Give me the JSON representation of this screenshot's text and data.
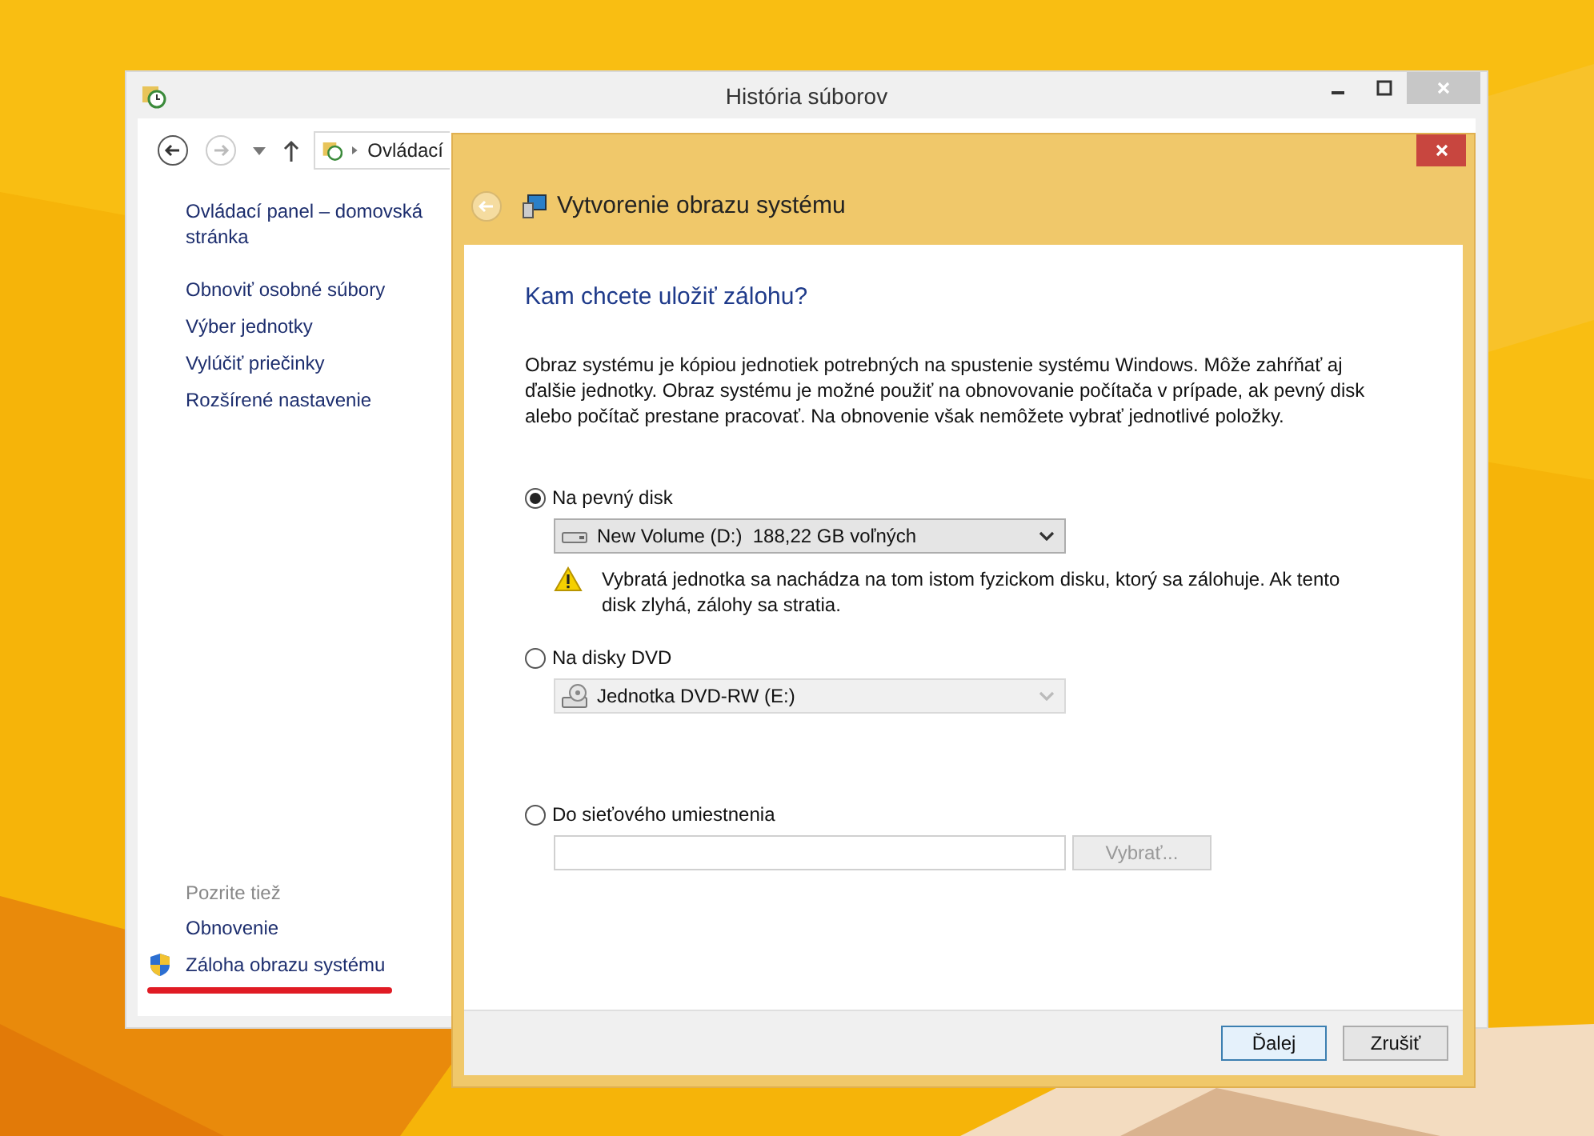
{
  "back_window": {
    "title": "História súborov",
    "address": "Ovládací",
    "links": [
      "Ovládací panel – domovská stránka",
      "Obnoviť osobné súbory",
      "Výber jednotky",
      "Vylúčiť priečinky",
      "Rozšírené nastavenie"
    ],
    "see_also": {
      "heading": "Pozrite tiež",
      "items": [
        {
          "label": "Obnovenie",
          "shield": false,
          "underlined": false
        },
        {
          "label": "Záloha obrazu systému",
          "shield": true,
          "underlined": true
        }
      ]
    }
  },
  "dialog": {
    "title": "Vytvorenie obrazu systému",
    "heading": "Kam chcete uložiť zálohu?",
    "description": "Obraz systému je kópiou jednotiek potrebných na spustenie systému Windows. Môže zahŕňať aj ďalšie jednotky. Obraz systému je možné použiť na obnovovanie počítača v prípade, ak pevný disk alebo počítač prestane pracovať. Na obnovenie však nemôžete vybrať jednotlivé položky.",
    "options": [
      {
        "kind": "drive",
        "label": "Na pevný disk",
        "selected": true,
        "dropdown": {
          "kind": "hdd",
          "value": "New Volume (D:)  188,22 GB voľných",
          "disabled": false
        },
        "warning": "Vybratá jednotka sa nachádza na tom istom fyzickom disku, ktorý sa zálohuje. Ak tento disk zlyhá, zálohy sa stratia."
      },
      {
        "kind": "drive",
        "label": "Na disky DVD",
        "selected": false,
        "dropdown": {
          "kind": "dvd",
          "value": "Jednotka DVD-RW (E:)",
          "disabled": true
        }
      },
      {
        "kind": "network",
        "label": "Do sieťového umiestnenia",
        "selected": false,
        "browse": {
          "label": "Vybrať...",
          "disabled": true
        }
      }
    ],
    "buttons": [
      {
        "label": "Ďalej",
        "default": true
      },
      {
        "label": "Zrušiť",
        "default": false
      }
    ]
  }
}
